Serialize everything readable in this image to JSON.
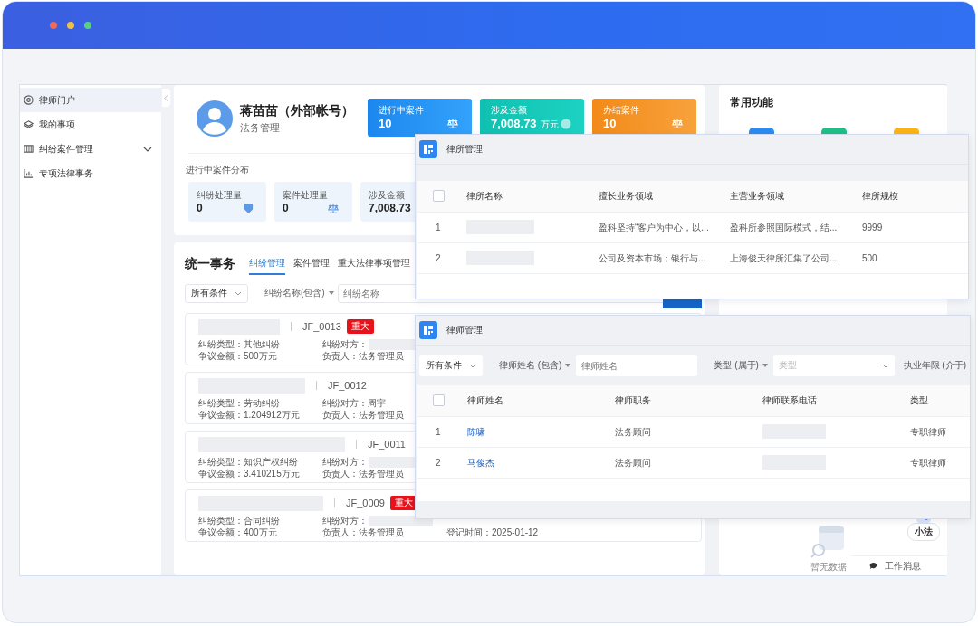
{
  "sidebar": {
    "items": [
      {
        "label": "律师门户",
        "kind": "link",
        "selected": true
      },
      {
        "label": "我的事项",
        "kind": "link",
        "selected": false
      },
      {
        "label": "纠纷案件管理",
        "kind": "group",
        "selected": false,
        "expanded": false
      },
      {
        "label": "专项法律事务",
        "kind": "link",
        "selected": false
      }
    ]
  },
  "profile": {
    "name": "蒋苗苗（外部帐号）",
    "role": "法务管理",
    "stats": [
      {
        "kind": "cases",
        "label": "进行中案件",
        "value": "10"
      },
      {
        "kind": "amount",
        "label": "涉及金额",
        "value": "7,008.73",
        "unit": "万元"
      },
      {
        "kind": "closed",
        "label": "办结案件",
        "value": "10"
      }
    ],
    "distribution_title": "进行中案件分布",
    "distribution": [
      {
        "kind": "disputes",
        "label": "纠纷处理量",
        "value": "0"
      },
      {
        "kind": "cases",
        "label": "案件处理量",
        "value": "0"
      },
      {
        "kind": "amount",
        "label": "涉及金额",
        "value": "7,008.73"
      }
    ]
  },
  "affairs": {
    "title": "统一事务",
    "tabs": [
      {
        "label": "纠纷管理",
        "selected": true
      },
      {
        "label": "案件管理",
        "selected": false
      },
      {
        "label": "重大法律事项管理",
        "selected": false
      }
    ],
    "filter": {
      "scope": "所有条件",
      "field": "纠纷名称(包含)",
      "placeholder": "纠纷名称"
    },
    "cases": [
      {
        "code": "JF_0013",
        "tag": "重大",
        "columns": [
          [
            {
              "kind": "text",
              "text": "纠纷类型：其他纠纷"
            },
            {
              "kind": "text",
              "text": "争议金额：500万元"
            }
          ],
          [
            {
              "kind": "redacted",
              "text": "纠纷对方："
            },
            {
              "kind": "text",
              "text": "负责人：法务管理员"
            }
          ]
        ]
      },
      {
        "code": "JF_0012",
        "columns": [
          [
            {
              "kind": "text",
              "text": "纠纷类型：劳动纠纷"
            },
            {
              "kind": "text",
              "text": "争议金额：1.204912万元"
            }
          ],
          [
            {
              "kind": "text",
              "text": "纠纷对方：周宇"
            },
            {
              "kind": "text",
              "text": "负责人：法务管理员"
            }
          ]
        ]
      },
      {
        "code": "JF_0011",
        "columns": [
          [
            {
              "kind": "text",
              "text": "纠纷类型：知识产权纠纷"
            },
            {
              "kind": "text",
              "text": "争议金额：3.410215万元"
            }
          ],
          [
            {
              "kind": "redacted",
              "text": "纠纷对方："
            },
            {
              "kind": "text",
              "text": "负责人：法务管理员"
            }
          ]
        ]
      },
      {
        "code": "JF_0009",
        "tag": "重大",
        "columns": [
          [
            {
              "kind": "text",
              "text": "纠纷类型：合同纠纷"
            },
            {
              "kind": "text",
              "text": "争议金额：400万元"
            }
          ],
          [
            {
              "kind": "redacted",
              "text": "纠纷对方："
            },
            {
              "kind": "text",
              "text": "负责人：法务管理员"
            }
          ],
          [
            {
              "kind": "text",
              "text": "登记时间：2025-01-12"
            }
          ]
        ]
      }
    ]
  },
  "shortcuts": {
    "title": "常用功能",
    "empty_text": "暂无数据",
    "assistant": "小法",
    "messages": "工作消息"
  },
  "firm_window": {
    "title": "律所管理",
    "all_checked": false,
    "columns": [
      "律所名称",
      "擅长业务领域",
      "主营业务领域",
      "律所规模"
    ],
    "rows": [
      {
        "index": "1",
        "specialty": "盈科坚持“客户为中心，以...",
        "main_business": "盈科所参照国际模式，结...",
        "size": "9999"
      },
      {
        "index": "2",
        "specialty": "公司及资本市场；银行与...",
        "main_business": "上海俊天律所汇集了公司...",
        "size": "500"
      }
    ]
  },
  "lawyer_window": {
    "title": "律师管理",
    "all_checked": false,
    "filters": {
      "scope": "所有条件",
      "name_label": "律师姓名 (包含)",
      "name_placeholder": "律师姓名",
      "type_label": "类型 (属于)",
      "type_placeholder": "类型",
      "years_label": "执业年限 (介于)"
    },
    "columns": [
      "律师姓名",
      "律师职务",
      "律师联系电话",
      "类型"
    ],
    "rows": [
      {
        "index": "1",
        "name": "陈啸",
        "position": "法务顾问",
        "type": "专职律师"
      },
      {
        "index": "2",
        "name": "马俊杰",
        "position": "法务顾问",
        "type": "专职律师"
      }
    ]
  }
}
